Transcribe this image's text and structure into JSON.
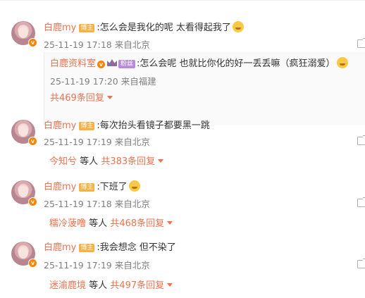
{
  "comments": [
    {
      "name": "白鹿my",
      "tag": "博主",
      "text": ":怎么会是我化的呢 太看得起我了",
      "emoji": "smile-emoji",
      "time": "25-11-19 17:18",
      "location": "来自北京",
      "reply": {
        "name": "白鹿资料室",
        "tag": "粉丝",
        "text": ":怎么会呢 也就比你化的好一丢丢嘛（疯狂溺爱）",
        "emoji": "hug-emoji",
        "time": "25-11-19 17:20",
        "location": "来自福建",
        "more": "共469条回复"
      }
    },
    {
      "name": "白鹿my",
      "tag": "博主",
      "text": ":每次抬头看镜子都要黑一跳",
      "time": "25-11-19 17:19",
      "location": "来自北京",
      "replier": "今知兮",
      "etc": "等人",
      "more": "共383条回复"
    },
    {
      "name": "白鹿my",
      "tag": "博主",
      "text": ":下班了",
      "emoji": "wave-emoji",
      "time": "25-11-19 17:18",
      "location": "来自北京",
      "replier": "糯冷菠噜",
      "etc": "等人",
      "more": "共468条回复"
    },
    {
      "name": "白鹿my",
      "tag": "博主",
      "text": ":我会想念 但不染了",
      "time": "25-11-19 17:19",
      "location": "来自北京",
      "replier": "迷渝鹿境",
      "etc": "等人",
      "more": "共497条回复"
    }
  ],
  "colors": {
    "link": "#eb7350",
    "meta": "#808080",
    "badge": "#ff8200"
  }
}
